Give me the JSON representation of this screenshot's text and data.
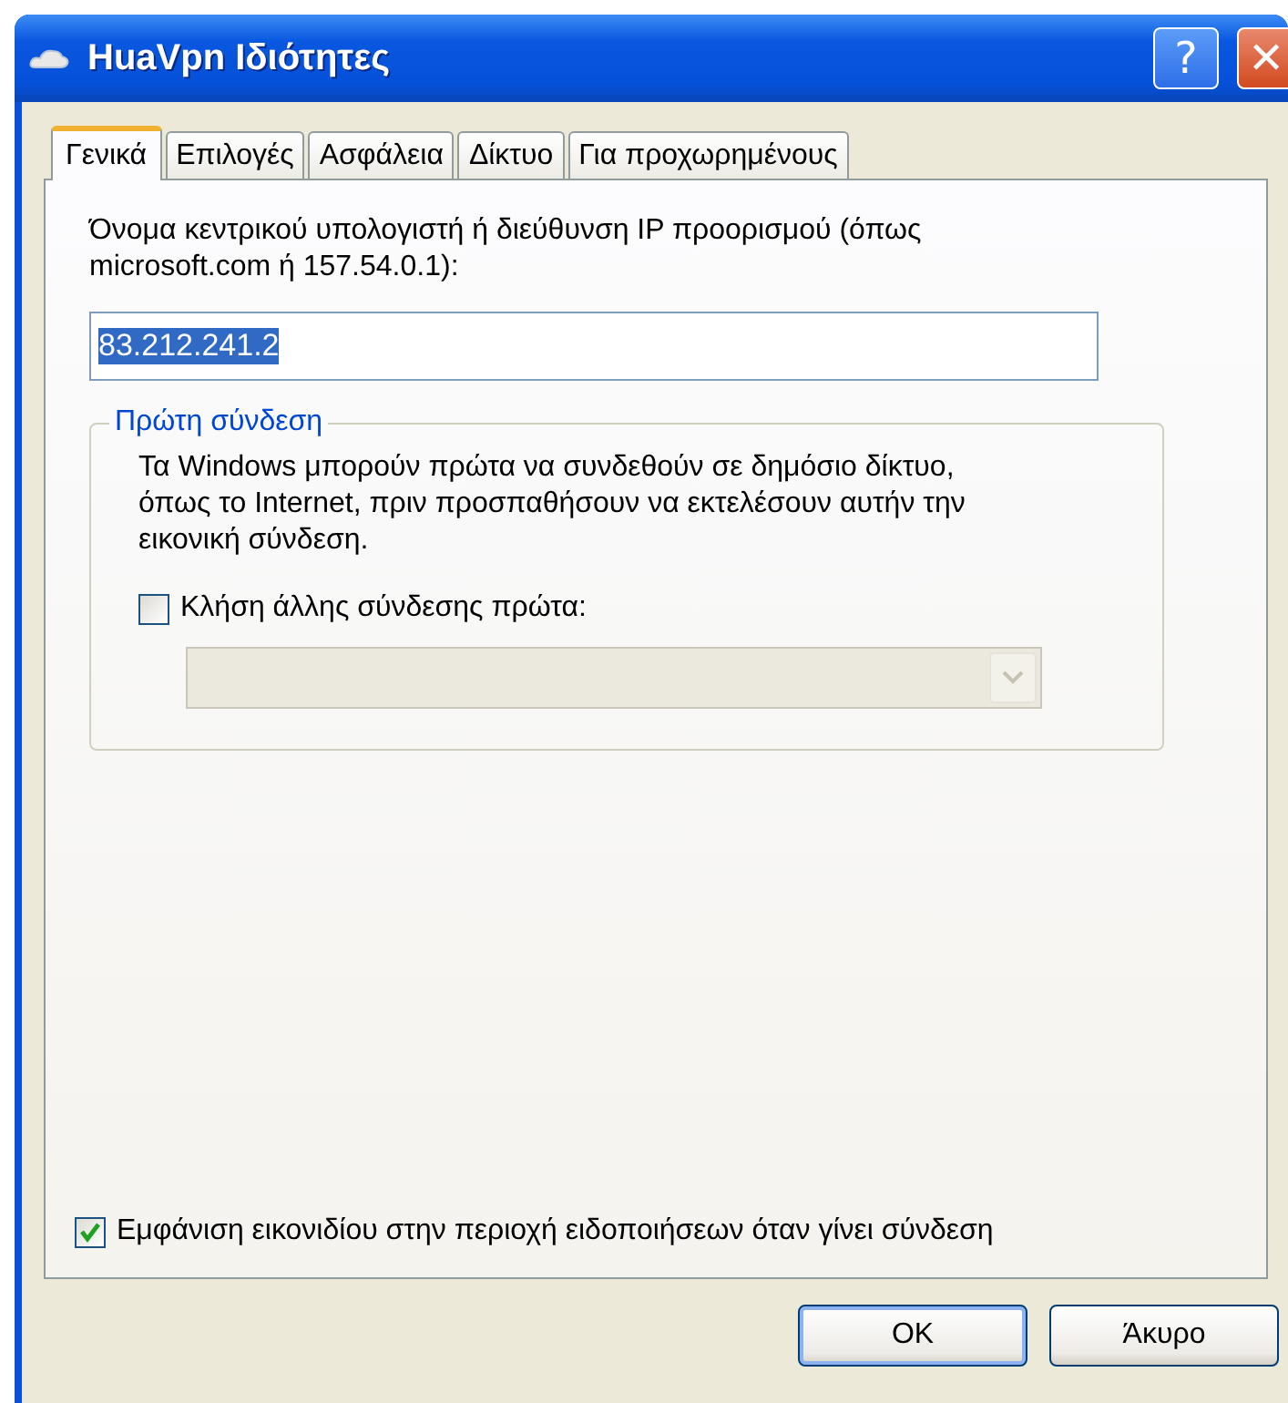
{
  "window": {
    "title": "HuaVpn Ιδιότητες",
    "help_button": "?",
    "close_button": "✕"
  },
  "tabs": [
    {
      "label": "Γενικά",
      "selected": true
    },
    {
      "label": "Επιλογές",
      "selected": false
    },
    {
      "label": "Ασφάλεια",
      "selected": false
    },
    {
      "label": "Δίκτυο",
      "selected": false
    },
    {
      "label": "Για προχωρημένους",
      "selected": false
    }
  ],
  "host": {
    "label": "Όνομα κεντρικού υπολογιστή ή διεύθυνση IP προορισμού (όπως microsoft.com ή 157.54.0.1):",
    "value": "83.212.241.2",
    "text_selected": true
  },
  "first_connection": {
    "legend": "Πρώτη σύνδεση",
    "description": "Τα Windows μπορούν πρώτα να συνδεθούν σε δημόσιο δίκτυο, όπως το Internet, πριν προσπαθήσουν να εκτελέσουν αυτήν την εικονική σύνδεση.",
    "dial_first": {
      "label": "Κλήση άλλης σύνδεσης πρώτα:",
      "checked": false
    },
    "connection_select": {
      "disabled": true
    }
  },
  "show_icon": {
    "label": "Εμφάνιση εικονιδίου στην περιοχή ειδοποιήσεων όταν γίνει σύνδεση",
    "checked": true
  },
  "buttons": [
    {
      "label": "OK",
      "default": true
    },
    {
      "label": "Άκυρο",
      "default": false
    }
  ]
}
